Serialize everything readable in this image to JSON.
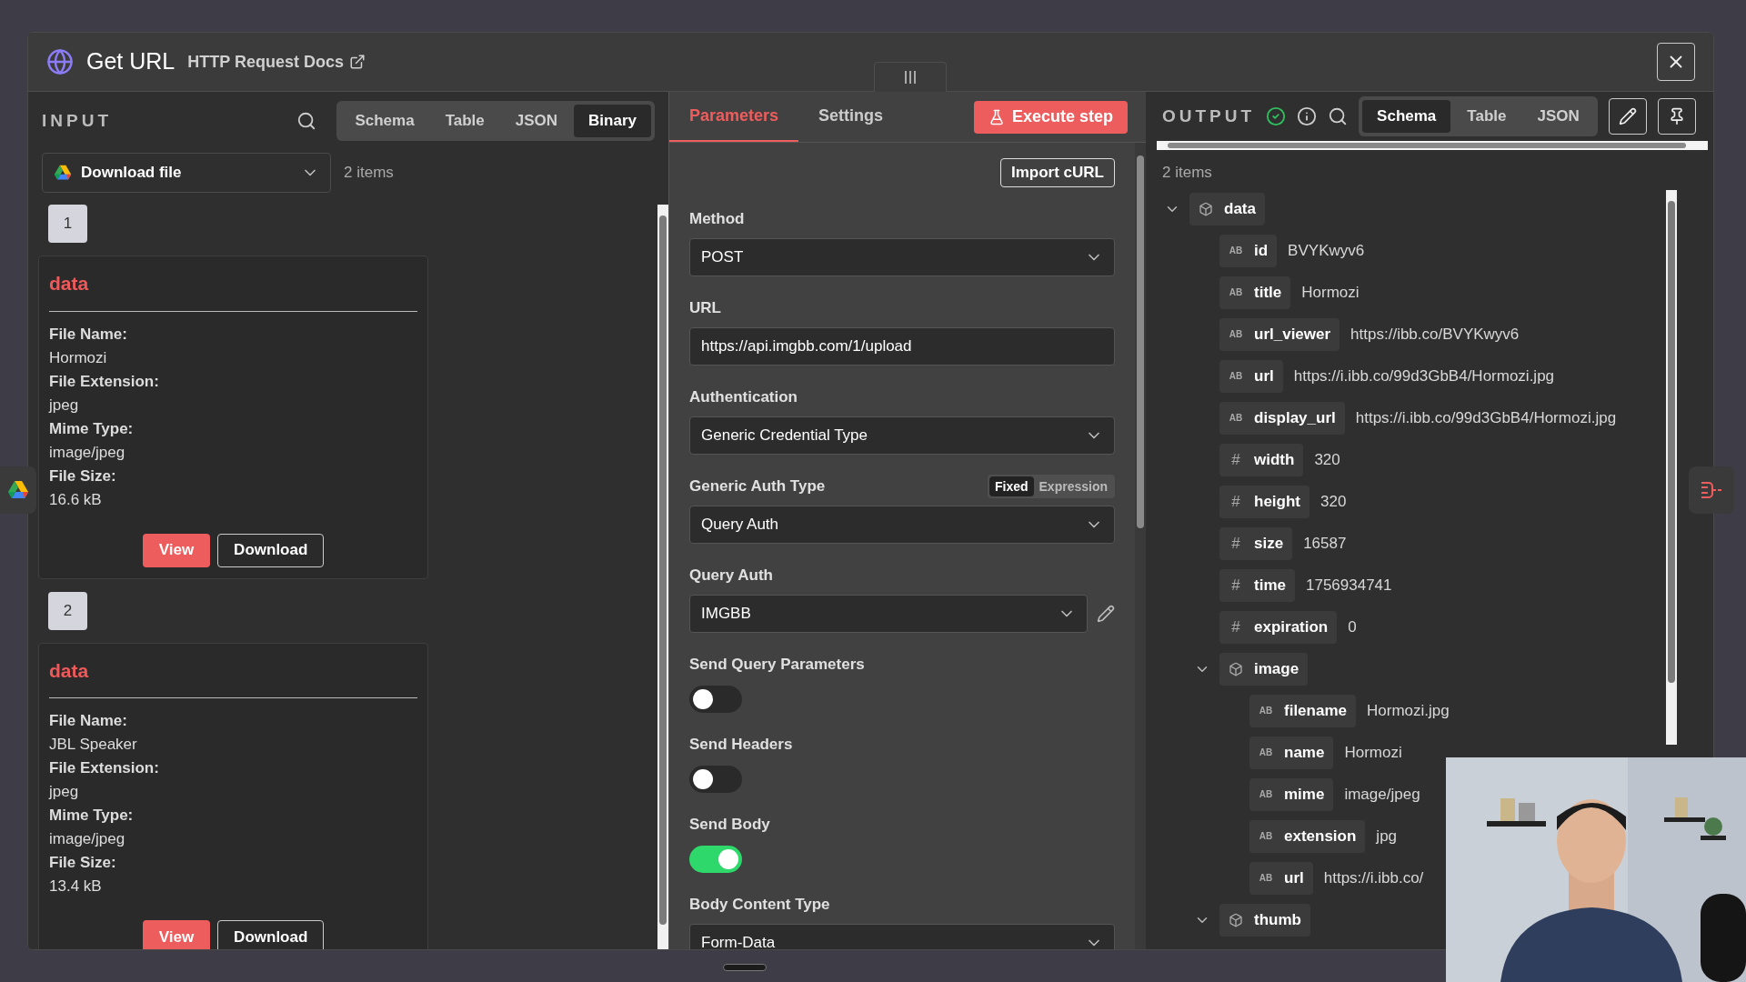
{
  "header": {
    "title": "Get URL",
    "docs_link": "HTTP Request Docs"
  },
  "input": {
    "title": "INPUT",
    "tabs": [
      {
        "label": "Schema",
        "selected": false
      },
      {
        "label": "Table",
        "selected": false
      },
      {
        "label": "JSON",
        "selected": false
      },
      {
        "label": "Binary",
        "selected": true
      }
    ],
    "node_select": "Download file",
    "count": "2 items",
    "items": [
      {
        "index": "1",
        "title": "data",
        "fields": [
          {
            "label": "File Name:",
            "value": "Hormozi"
          },
          {
            "label": "File Extension:",
            "value": "jpeg"
          },
          {
            "label": "Mime Type:",
            "value": "image/jpeg"
          },
          {
            "label": "File Size:",
            "value": "16.6 kB"
          }
        ],
        "buttons": [
          "View",
          "Download"
        ]
      },
      {
        "index": "2",
        "title": "data",
        "fields": [
          {
            "label": "File Name:",
            "value": "JBL Speaker"
          },
          {
            "label": "File Extension:",
            "value": "jpeg"
          },
          {
            "label": "Mime Type:",
            "value": "image/jpeg"
          },
          {
            "label": "File Size:",
            "value": "13.4 kB"
          }
        ],
        "buttons": [
          "View",
          "Download"
        ]
      }
    ]
  },
  "parameters": {
    "tabs": [
      {
        "label": "Parameters",
        "selected": true
      },
      {
        "label": "Settings",
        "selected": false
      }
    ],
    "execute": "Execute step",
    "fields": [
      {
        "kind": "button",
        "label": "Import cURL"
      },
      {
        "kind": "select",
        "label": "Method",
        "value": "POST"
      },
      {
        "kind": "input",
        "label": "URL",
        "value": "https://api.imgbb.com/1/upload"
      },
      {
        "kind": "select",
        "label": "Authentication",
        "value": "Generic Credential Type"
      },
      {
        "kind": "select",
        "label": "Generic Auth Type",
        "value": "Query Auth",
        "modes": [
          {
            "label": "Fixed",
            "selected": true
          },
          {
            "label": "Expression",
            "selected": false
          }
        ]
      },
      {
        "kind": "credential",
        "label": "Query Auth",
        "value": "IMGBB"
      },
      {
        "kind": "toggle",
        "label": "Send Query Parameters",
        "on": false
      },
      {
        "kind": "toggle",
        "label": "Send Headers",
        "on": false
      },
      {
        "kind": "toggle",
        "label": "Send Body",
        "on": true
      },
      {
        "kind": "select",
        "label": "Body Content Type",
        "value": "Form-Data"
      }
    ]
  },
  "output": {
    "title": "OUTPUT",
    "tabs": [
      {
        "label": "Schema",
        "selected": true
      },
      {
        "label": "Table",
        "selected": false
      },
      {
        "label": "JSON",
        "selected": false
      }
    ],
    "count": "2 items",
    "tree": [
      {
        "kind": "object",
        "key": "data",
        "expanded": true,
        "children": [
          {
            "kind": "string",
            "type_mark": "AB",
            "key": "id",
            "value": "BVYKwyv6"
          },
          {
            "kind": "string",
            "type_mark": "AB",
            "key": "title",
            "value": "Hormozi"
          },
          {
            "kind": "string",
            "type_mark": "AB",
            "key": "url_viewer",
            "value": "https://ibb.co/BVYKwyv6"
          },
          {
            "kind": "string",
            "type_mark": "AB",
            "key": "url",
            "value": "https://i.ibb.co/99d3GbB4/Hormozi.jpg"
          },
          {
            "kind": "string",
            "type_mark": "AB",
            "key": "display_url",
            "value": "https://i.ibb.co/99d3GbB4/Hormozi.jpg"
          },
          {
            "kind": "number",
            "type_mark": "#",
            "key": "width",
            "value": "320"
          },
          {
            "kind": "number",
            "type_mark": "#",
            "key": "height",
            "value": "320"
          },
          {
            "kind": "number",
            "type_mark": "#",
            "key": "size",
            "value": "16587"
          },
          {
            "kind": "number",
            "type_mark": "#",
            "key": "time",
            "value": "1756934741"
          },
          {
            "kind": "number",
            "type_mark": "#",
            "key": "expiration",
            "value": "0"
          },
          {
            "kind": "object",
            "key": "image",
            "expanded": true,
            "children": [
              {
                "kind": "string",
                "type_mark": "AB",
                "key": "filename",
                "value": "Hormozi.jpg"
              },
              {
                "kind": "string",
                "type_mark": "AB",
                "key": "name",
                "value": "Hormozi"
              },
              {
                "kind": "string",
                "type_mark": "AB",
                "key": "mime",
                "value": "image/jpeg"
              },
              {
                "kind": "string",
                "type_mark": "AB",
                "key": "extension",
                "value": "jpg"
              },
              {
                "kind": "string",
                "type_mark": "AB",
                "key": "url",
                "value": "https://i.ibb.co/"
              }
            ]
          },
          {
            "kind": "object",
            "key": "thumb",
            "expanded": true
          }
        ]
      }
    ]
  }
}
